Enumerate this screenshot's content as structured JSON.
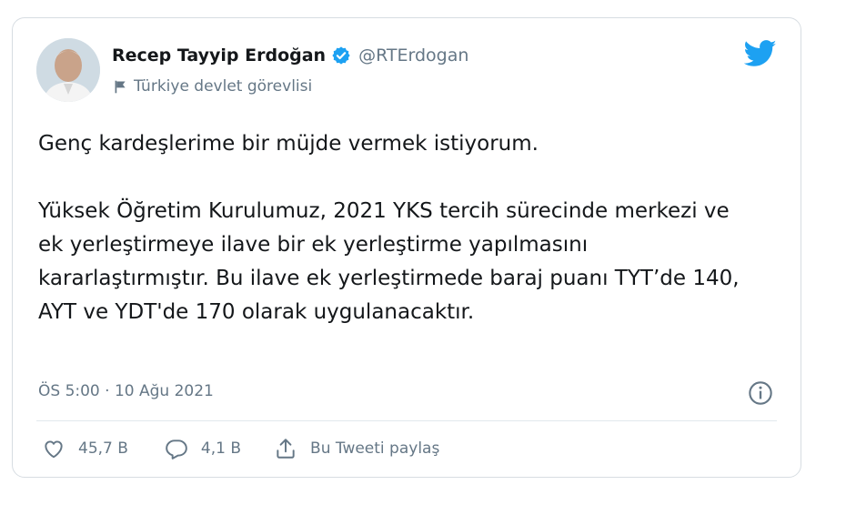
{
  "tweet": {
    "display_name": "Recep Tayyip Erdoğan",
    "handle": "@RTErdogan",
    "account_label": "Türkiye devlet görevlisi",
    "text_paragraph_1": "Genç kardeşlerime bir müjde vermek istiyorum.",
    "text_paragraph_2": "Yüksek Öğretim Kurulumuz, 2021 YKS tercih sürecinde merkezi ve ek yerleştirmeye ilave bir ek yerleştirme yapılmasını kararlaştırmıştır. Bu ilave ek yerleştirmede baraj puanı TYT’de 140, AYT ve YDT'de 170 olarak uygulanacaktır.",
    "timestamp": "ÖS 5:00 · 10 Ağu 2021"
  },
  "actions": {
    "like_count": "45,7 B",
    "reply_count": "4,1 B",
    "share_label": "Bu Tweeti paylaş"
  },
  "icons": {
    "verified": "verified-badge-icon",
    "flag": "flag-icon",
    "bird": "twitter-bird-icon",
    "info": "info-icon",
    "like": "heart-icon",
    "reply": "reply-bubble-icon",
    "share": "share-icon"
  },
  "colors": {
    "brand_blue": "#1da1f2",
    "text_primary": "#14171a",
    "text_secondary": "#657786",
    "border": "#d7dde2"
  }
}
